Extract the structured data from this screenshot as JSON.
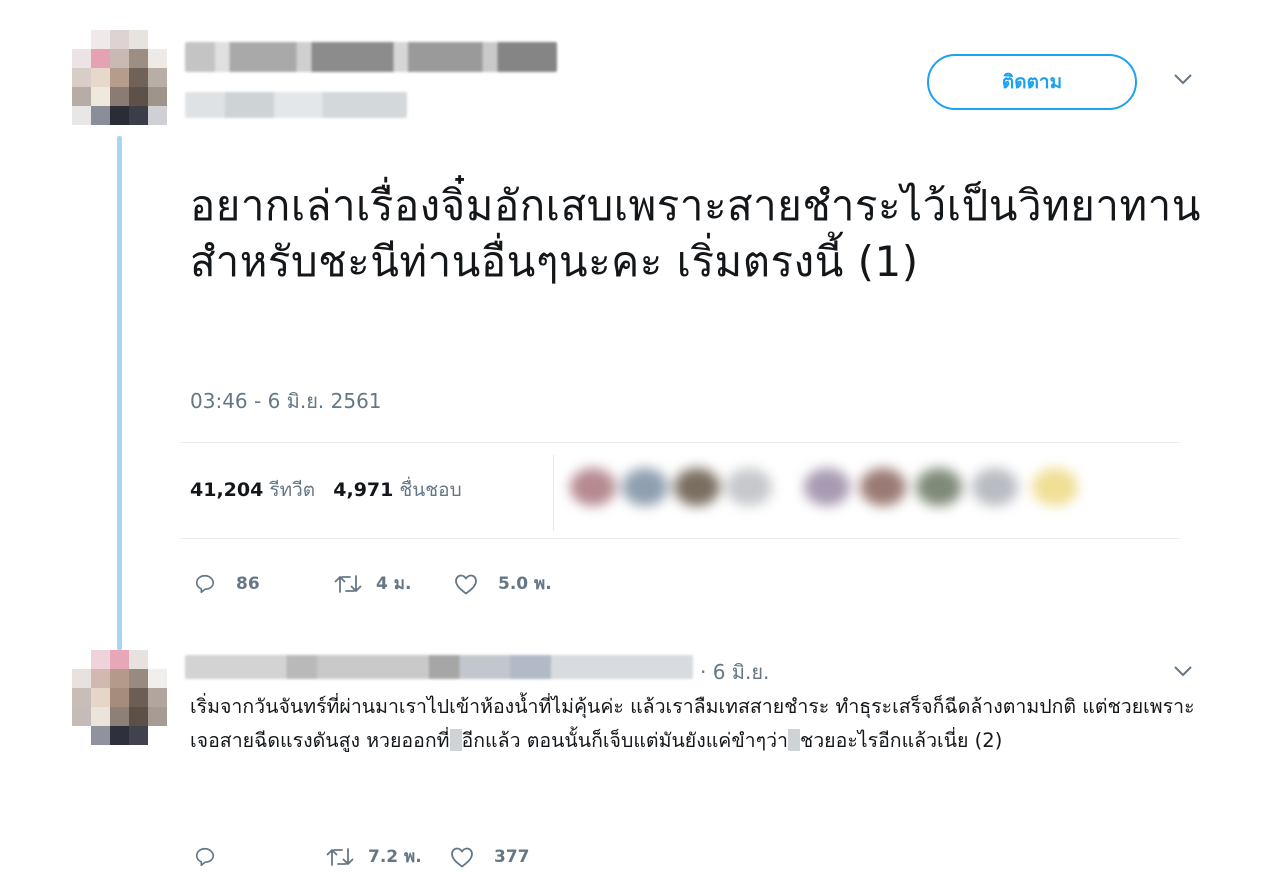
{
  "tweet": {
    "follow_label": "ติดตาม",
    "text": "อยากเล่าเรื่องจิ๋มอักเสบเพราะสายชำระไว้เป็นวิทยาทานสำหรับชะนีท่านอื่นๆนะคะ เริ่มตรงนี้ (1)",
    "timestamp": "03:46 - 6 มิ.ย. 2561",
    "retweets_count": "41,204",
    "retweets_label": "รีทวีต",
    "likes_count": "4,971",
    "likes_label": "ชื่นชอบ",
    "actions": {
      "reply": "86",
      "retweet": "4 ม.",
      "like": "5.0 พ."
    }
  },
  "reply": {
    "date": "· 6 มิ.ย.",
    "text_1": "เริ่มจากวันจันทร์ที่ผ่านมาเราไปเข้าห้องน้ำที่ไม่คุ้นค่ะ แล้วเราลืมเทสสายชำระ ทำธุระเสร็จก็ฉีดล้างตามปกติ แต่ชวยเพราะเจอสายฉีดแรงดันสูง หวยออกที่",
    "text_2": "อีกแล้ว ตอนนั้นก็เจ็บแต่มันยังแค่ขำๆว่า",
    "text_3": "ชวยอะไรอีกแล้วเนี่ย (2)",
    "actions": {
      "reply": "",
      "retweet": "7.2 พ.",
      "like": "377"
    }
  },
  "icons": [
    "reply-icon",
    "retweet-icon",
    "like-icon",
    "chevron-down-icon"
  ],
  "colors": {
    "accent": "#1da1f2",
    "muted": "#657786",
    "thread_line": "#a6d6f2"
  }
}
